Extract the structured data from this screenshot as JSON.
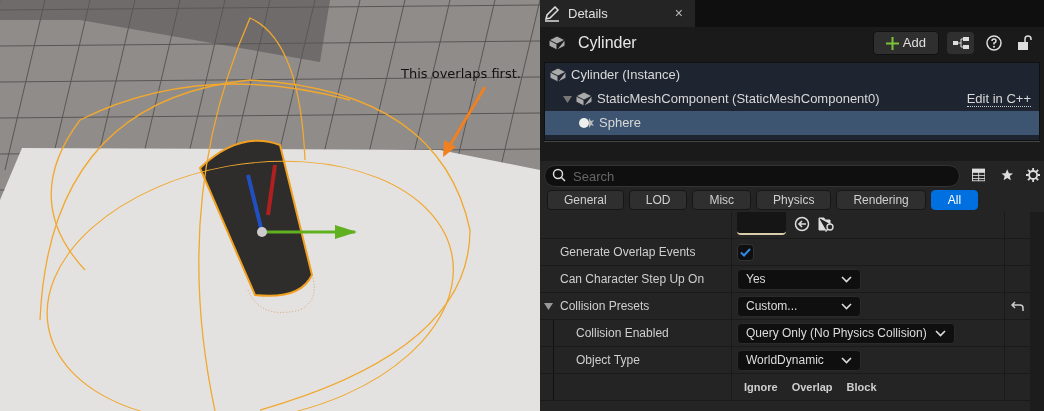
{
  "viewport": {
    "annotation": "This overlaps first."
  },
  "details": {
    "tab": {
      "title": "Details",
      "close": "×"
    },
    "header": {
      "title": "Cylinder",
      "add_button": "Add"
    },
    "components": [
      {
        "label": "Cylinder (Instance)",
        "selected": false,
        "children": [
          {
            "label": "StaticMeshComponent (StaticMeshComponent0)",
            "selected": false,
            "expanded": true,
            "link": "Edit in C++",
            "children": [
              {
                "label": "Sphere",
                "selected": true
              }
            ]
          }
        ]
      }
    ],
    "search": {
      "placeholder": "Search"
    },
    "filters": [
      {
        "label": "General",
        "selected": false
      },
      {
        "label": "LOD",
        "selected": false
      },
      {
        "label": "Misc",
        "selected": false
      },
      {
        "label": "Physics",
        "selected": false
      },
      {
        "label": "Rendering",
        "selected": false
      },
      {
        "label": "All",
        "selected": true
      }
    ],
    "properties": [
      {
        "kind": "asset"
      },
      {
        "kind": "checkbox",
        "label": "Generate Overlap Events",
        "checked": true
      },
      {
        "kind": "dropdown",
        "label": "Can Character Step Up On",
        "value": "Yes"
      },
      {
        "kind": "section",
        "label": "Collision Presets",
        "value": "Custom...",
        "expanded": true,
        "resettable": true,
        "children": [
          {
            "kind": "dropdown",
            "label": "Collision Enabled",
            "value": "Query Only (No Physics Collision)"
          },
          {
            "kind": "dropdown",
            "label": "Object Type",
            "value": "WorldDynamic"
          },
          {
            "kind": "columns",
            "labels": [
              "Ignore",
              "Overlap",
              "Block"
            ]
          }
        ]
      }
    ]
  }
}
